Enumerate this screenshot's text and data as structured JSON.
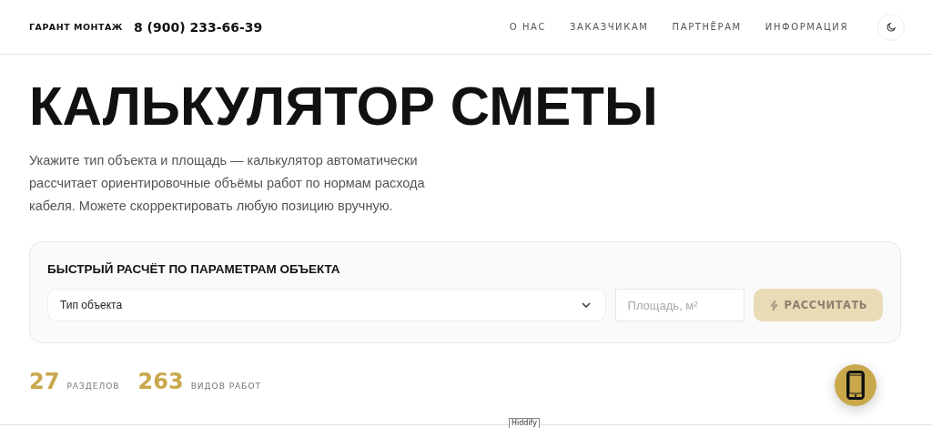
{
  "header": {
    "brand": "ГАРАНТ МОНТАЖ",
    "phone": "8 (900) 233-66-39",
    "nav": [
      {
        "label": "О НАС"
      },
      {
        "label": "ЗАКАЗЧИКАМ"
      },
      {
        "label": "ПАРТНЁРАМ"
      },
      {
        "label": "ИНФОРМАЦИЯ"
      }
    ]
  },
  "title": "КАЛЬКУЛЯТОР СМЕТЫ",
  "description": "Укажите тип объекта и площадь — калькулятор автоматически рассчитает ориентировочные объёмы работ по нормам расхода кабеля. Можете скорректировать любую позицию вручную.",
  "quick_calc": {
    "heading": "БЫСТРЫЙ РАСЧЁТ ПО ПАРАМЕТРАМ ОБЪЕКТА",
    "object_type": {
      "value": "Тип объекта"
    },
    "area": {
      "placeholder": "Площадь, м²"
    },
    "button": {
      "label": "РАССЧИТАТЬ",
      "disabled": true
    }
  },
  "stats": [
    {
      "number": "27",
      "label": "РАЗДЕЛОВ"
    },
    {
      "number": "263",
      "label": "ВИДОВ РАБОТ"
    }
  ],
  "tooltip": "Hiddify"
}
